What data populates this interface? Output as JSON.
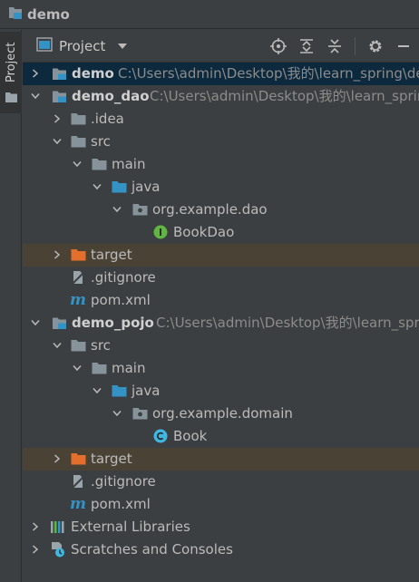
{
  "window": {
    "title": "demo"
  },
  "sidebar": {
    "project_tab": "Project"
  },
  "toolbar": {
    "view_label": "Project"
  },
  "tree": [
    {
      "label": "demo",
      "path": "C:\\Users\\admin\\Desktop\\我的\\learn_spring\\de",
      "bold": true
    },
    {
      "label": "demo_dao",
      "path": "C:\\Users\\admin\\Desktop\\我的\\learn_sprin",
      "bold": true
    },
    {
      "label": ".idea"
    },
    {
      "label": "src"
    },
    {
      "label": "main"
    },
    {
      "label": "java"
    },
    {
      "label": "org.example.dao"
    },
    {
      "label": "BookDao"
    },
    {
      "label": "target"
    },
    {
      "label": ".gitignore"
    },
    {
      "label": "pom.xml"
    },
    {
      "label": "demo_pojo",
      "path": "C:\\Users\\admin\\Desktop\\我的\\learn_spr",
      "bold": true
    },
    {
      "label": "src"
    },
    {
      "label": "main"
    },
    {
      "label": "java"
    },
    {
      "label": "org.example.domain"
    },
    {
      "label": "Book"
    },
    {
      "label": "target"
    },
    {
      "label": ".gitignore"
    },
    {
      "label": "pom.xml"
    },
    {
      "label": "External Libraries"
    },
    {
      "label": "Scratches and Consoles"
    }
  ],
  "colors": {
    "selected_row": "#0d293e",
    "excluded_row": "#4b4236",
    "folder": "#87939a",
    "source_folder": "#3592c4",
    "excluded_folder": "#e46f2d",
    "interface": "#62b543",
    "class": "#40b6e0"
  }
}
